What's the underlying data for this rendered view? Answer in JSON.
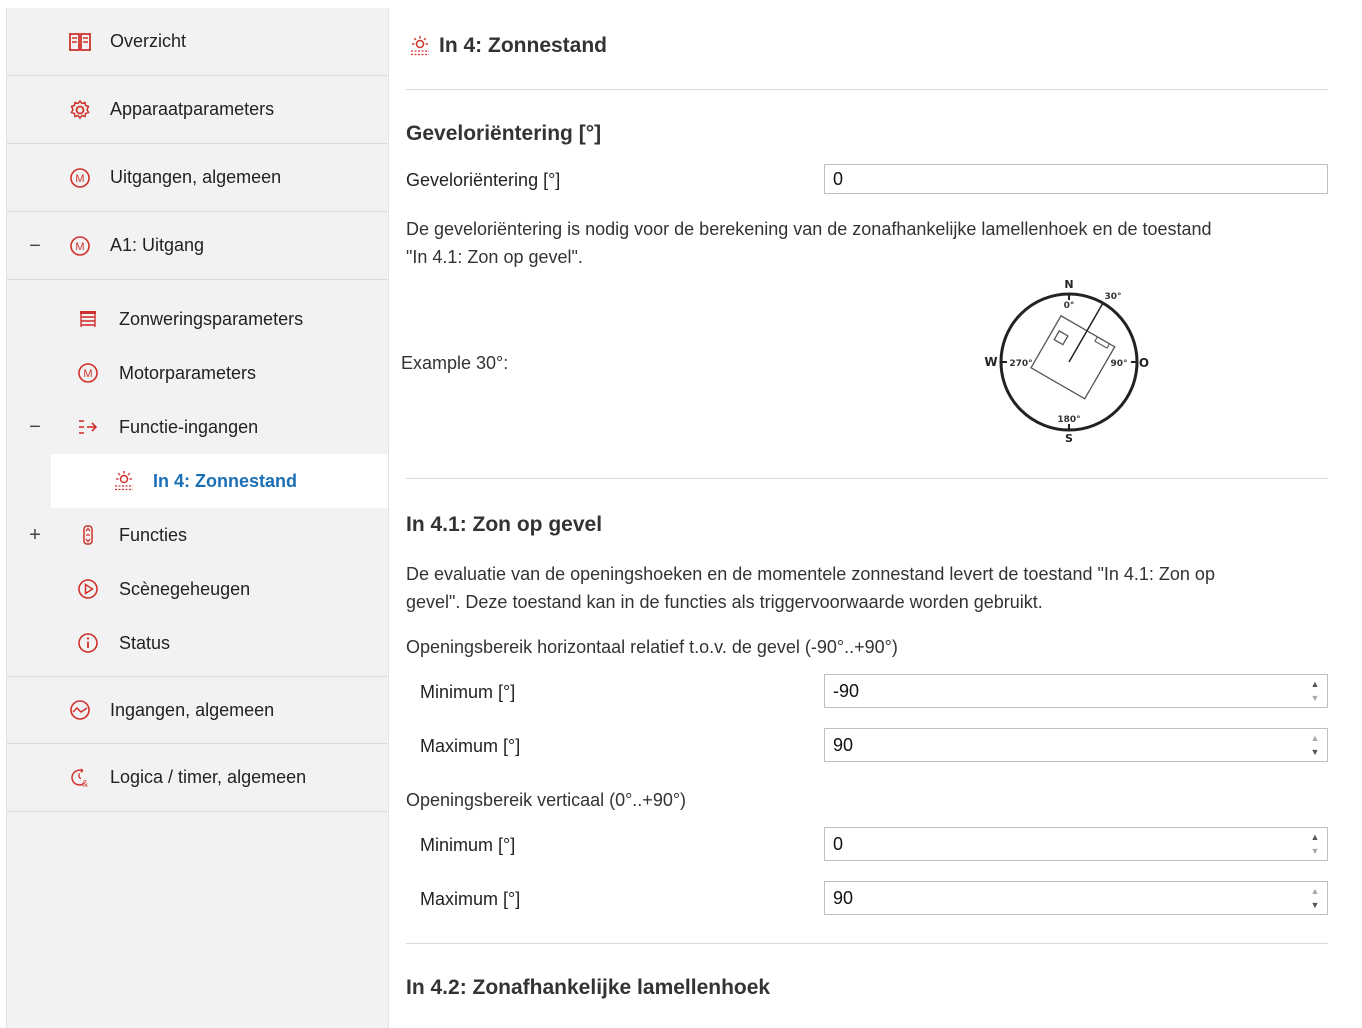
{
  "sidebar": {
    "items": [
      {
        "label": "Overzicht",
        "icon": "overview-icon"
      },
      {
        "label": "Apparaatparameters",
        "icon": "gear-icon"
      },
      {
        "label": "Uitgangen, algemeen",
        "icon": "motor-icon"
      },
      {
        "label": "A1: Uitgang",
        "icon": "motor-icon",
        "toggle": "−"
      }
    ],
    "subitems": [
      {
        "label": "Zonweringsparameters",
        "icon": "blinds-icon"
      },
      {
        "label": "Motorparameters",
        "icon": "motor-icon"
      },
      {
        "label": "Functie-ingangen",
        "icon": "input-arrow-icon",
        "toggle": "−"
      },
      {
        "label": "In 4: Zonnestand",
        "icon": "sun-icon"
      },
      {
        "label": "Functies",
        "icon": "functions-icon",
        "toggle": "+"
      },
      {
        "label": "Scènegeheugen",
        "icon": "scene-play-icon"
      },
      {
        "label": "Status",
        "icon": "info-icon"
      }
    ],
    "bottom_items": [
      {
        "label": "Ingangen, algemeen",
        "icon": "inputs-icon"
      },
      {
        "label": "Logica / timer, algemeen",
        "icon": "logic-timer-icon"
      }
    ]
  },
  "main": {
    "title": "In 4: Zonnestand",
    "facade": {
      "heading": "Geveloriëntering [°]",
      "field_label": "Geveloriëntering [°]",
      "field_value": "0",
      "description_line1": "De geveloriëntering is nodig voor de berekening van de zonafhankelijke lamellenhoek en de toestand",
      "description_line2": "\"In 4.1: Zon op gevel\".",
      "example_label": "Example 30°:",
      "compass": {
        "n": "N",
        "s": "S",
        "w": "W",
        "o": "O",
        "deg0": "0°",
        "deg30": "30°",
        "deg90": "90°",
        "deg180": "180°",
        "deg270": "270°"
      }
    },
    "sun_on_facade": {
      "heading": "In 4.1: Zon op gevel",
      "description_line1": "De evaluatie van de openingshoeken en de momentele zonnestand levert de toestand \"In 4.1: Zon op",
      "description_line2": "gevel\". Deze toestand kan in de functies als triggervoorwaarde worden gebruikt.",
      "horizontal_label": "Openingsbereik horizontaal relatief t.o.v. de gevel (-90°..+90°)",
      "h_min_label": "Minimum [°]",
      "h_min_value": "-90",
      "h_max_label": "Maximum [°]",
      "h_max_value": "90",
      "vertical_label": "Openingsbereik verticaal (0°..+90°)",
      "v_min_label": "Minimum [°]",
      "v_min_value": "0",
      "v_max_label": "Maximum [°]",
      "v_max_value": "90"
    },
    "slat_angle": {
      "heading": "In 4.2: Zonafhankelijke lamellenhoek"
    }
  },
  "colors": {
    "accent": "#d0312d",
    "active_text": "#1a6fb5",
    "sidebar_bg": "#f2f2f2"
  }
}
